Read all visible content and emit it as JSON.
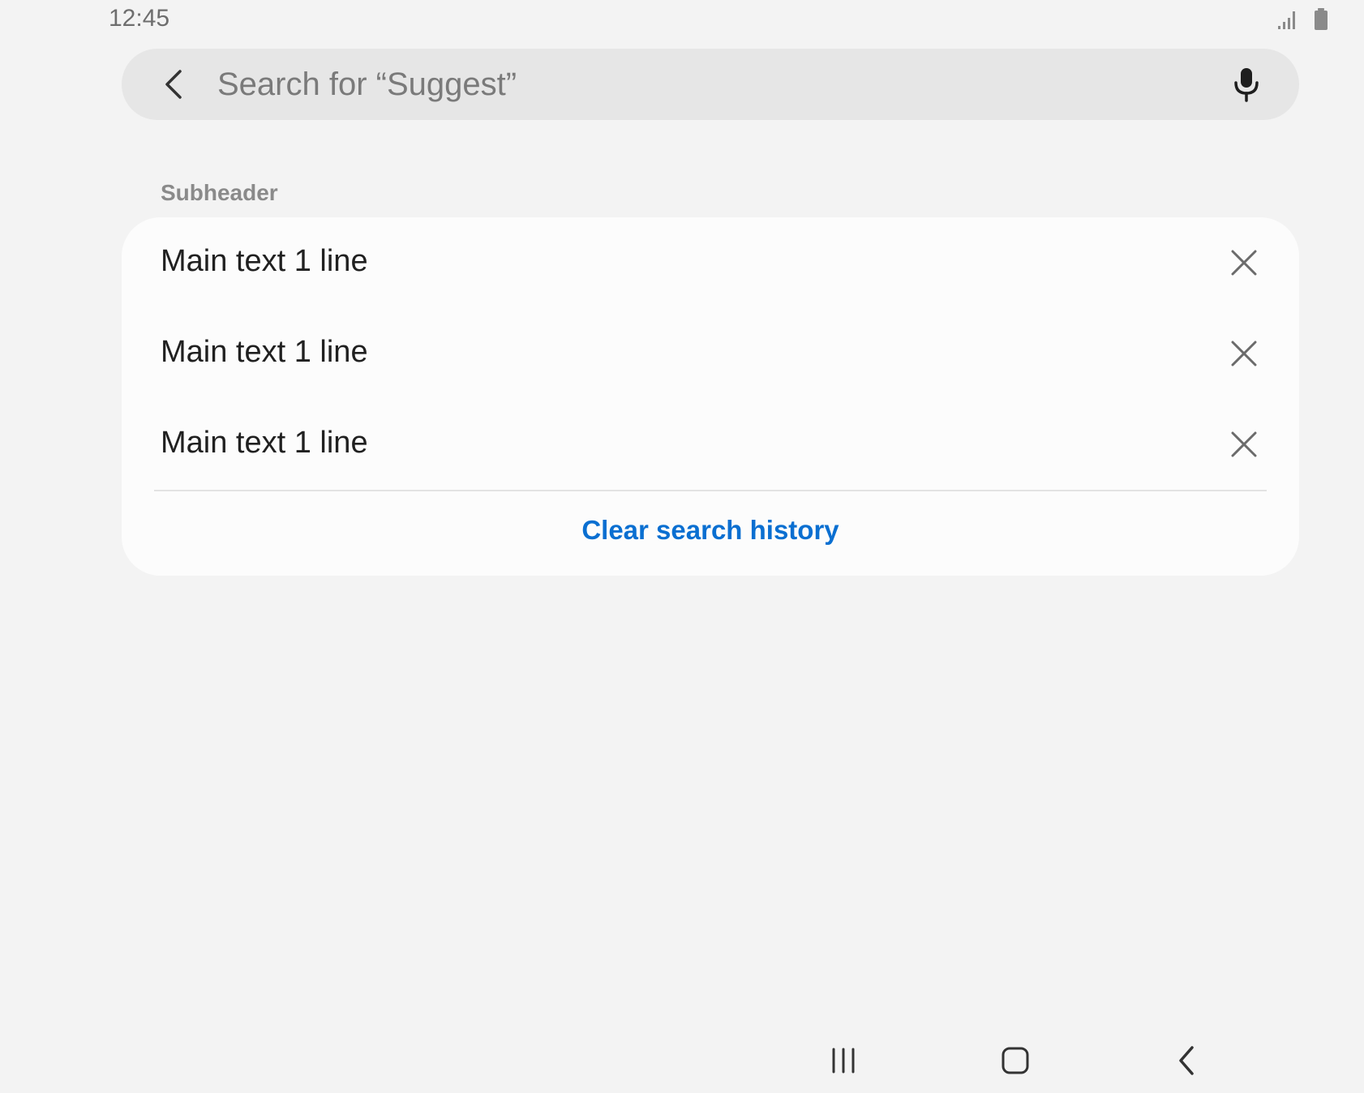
{
  "status_bar": {
    "time": "12:45",
    "signal_icon": "signal-icon",
    "battery_icon": "battery-icon"
  },
  "search": {
    "back_icon": "back-arrow-icon",
    "placeholder": "Search for “Suggest”",
    "value": "",
    "mic_icon": "microphone-icon"
  },
  "history": {
    "subheader": "Subheader",
    "items": [
      {
        "label": "Main text 1 line",
        "remove_icon": "close-icon"
      },
      {
        "label": "Main text 1 line",
        "remove_icon": "close-icon"
      },
      {
        "label": "Main text 1 line",
        "remove_icon": "close-icon"
      }
    ],
    "clear_label": "Clear search history"
  },
  "nav_bar": {
    "recents_icon": "recent-apps-icon",
    "home_icon": "home-icon",
    "back_icon": "nav-back-icon"
  },
  "colors": {
    "background": "#f3f3f3",
    "search_bar": "#e6e6e6",
    "card": "#fcfcfc",
    "accent": "#0a6fd1"
  }
}
